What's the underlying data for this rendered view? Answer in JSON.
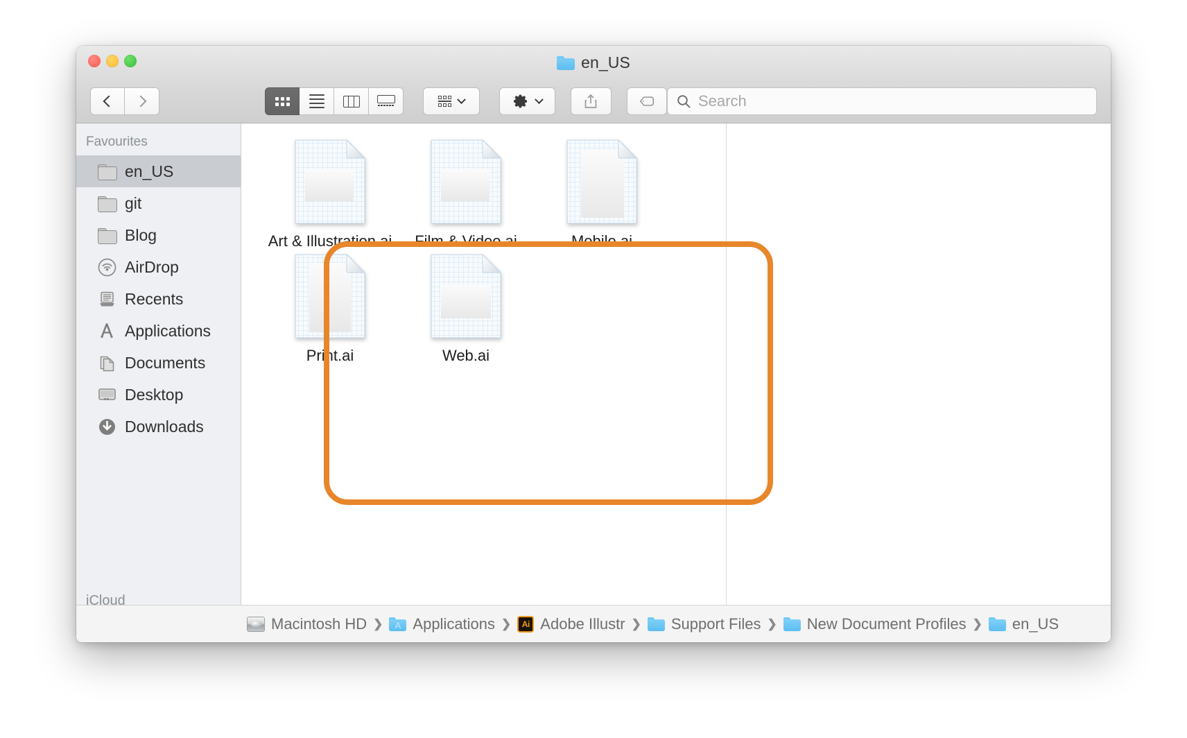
{
  "window": {
    "title": "en_US",
    "title_icon": "blue-folder-icon",
    "traffic_lights": [
      {
        "name": "close",
        "color": "#fc5c54"
      },
      {
        "name": "minimize",
        "color": "#fcbc2e"
      },
      {
        "name": "maximize",
        "color": "#3ac03a"
      }
    ]
  },
  "toolbar": {
    "back_label": "",
    "forward_label": "",
    "views": [
      {
        "name": "icon-view",
        "icon": "grid-icon",
        "active": true
      },
      {
        "name": "list-view",
        "icon": "list-icon",
        "active": false
      },
      {
        "name": "column-view",
        "icon": "columns-icon",
        "active": false
      },
      {
        "name": "gallery-view",
        "icon": "coverflow-icon",
        "active": false
      }
    ],
    "arrange_label": "",
    "action_label": "",
    "share_label": "",
    "tags_label": ""
  },
  "search": {
    "placeholder": "Search",
    "value": "",
    "icon": "search-icon"
  },
  "sidebar": {
    "section_header": "Favourites",
    "items": [
      {
        "label": "en_US",
        "icon": "grey-folder-icon",
        "selected": true
      },
      {
        "label": "git",
        "icon": "grey-folder-icon",
        "selected": false
      },
      {
        "label": "Blog",
        "icon": "grey-folder-icon",
        "selected": false
      },
      {
        "label": "AirDrop",
        "icon": "airdrop-icon",
        "selected": false
      },
      {
        "label": "Recents",
        "icon": "recents-icon",
        "selected": false
      },
      {
        "label": "Applications",
        "icon": "applications-icon",
        "selected": false
      },
      {
        "label": "Documents",
        "icon": "documents-icon",
        "selected": false
      },
      {
        "label": "Desktop",
        "icon": "desktop-icon",
        "selected": false
      },
      {
        "label": "Downloads",
        "icon": "downloads-icon",
        "selected": false
      }
    ],
    "next_section_header": "iCloud"
  },
  "files": [
    {
      "name": "Art & Illustration.ai",
      "icon": "ai-document-icon",
      "preview": "landscape-wide"
    },
    {
      "name": "Film & Video.ai",
      "icon": "ai-document-icon",
      "preview": "landscape-wide"
    },
    {
      "name": "Mobile.ai",
      "icon": "ai-document-icon",
      "preview": "portrait-tall"
    },
    {
      "name": "Print.ai",
      "icon": "ai-document-icon",
      "preview": "portrait-tall"
    },
    {
      "name": "Web.ai",
      "icon": "ai-document-icon",
      "preview": "landscape-wide"
    }
  ],
  "path_bar": {
    "separator": "❯",
    "crumbs": [
      {
        "label": "Macintosh HD",
        "icon": "hard-drive-icon"
      },
      {
        "label": "Applications",
        "icon": "applications-folder-icon"
      },
      {
        "label": "Adobe Illustr",
        "icon": "illustrator-app-icon",
        "truncated": true
      },
      {
        "label": "Support Files",
        "icon": "blue-folder-icon",
        "truncated": true
      },
      {
        "label": "New Document Profiles",
        "icon": "blue-folder-icon"
      },
      {
        "label": "en_US",
        "icon": "blue-folder-icon"
      }
    ]
  },
  "annotation": {
    "name": "orange-highlight-box",
    "color": "#e8862a",
    "stroke_width": 8
  }
}
